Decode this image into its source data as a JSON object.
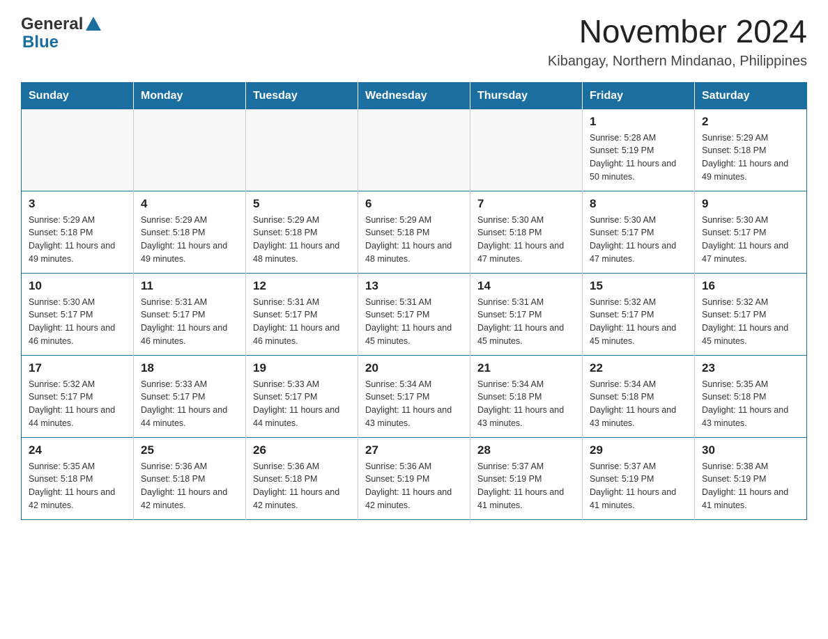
{
  "logo": {
    "text_general": "General",
    "text_blue": "Blue"
  },
  "title": "November 2024",
  "subtitle": "Kibangay, Northern Mindanao, Philippines",
  "days_of_week": [
    "Sunday",
    "Monday",
    "Tuesday",
    "Wednesday",
    "Thursday",
    "Friday",
    "Saturday"
  ],
  "weeks": [
    [
      {
        "day": "",
        "info": ""
      },
      {
        "day": "",
        "info": ""
      },
      {
        "day": "",
        "info": ""
      },
      {
        "day": "",
        "info": ""
      },
      {
        "day": "",
        "info": ""
      },
      {
        "day": "1",
        "info": "Sunrise: 5:28 AM\nSunset: 5:19 PM\nDaylight: 11 hours and 50 minutes."
      },
      {
        "day": "2",
        "info": "Sunrise: 5:29 AM\nSunset: 5:18 PM\nDaylight: 11 hours and 49 minutes."
      }
    ],
    [
      {
        "day": "3",
        "info": "Sunrise: 5:29 AM\nSunset: 5:18 PM\nDaylight: 11 hours and 49 minutes."
      },
      {
        "day": "4",
        "info": "Sunrise: 5:29 AM\nSunset: 5:18 PM\nDaylight: 11 hours and 49 minutes."
      },
      {
        "day": "5",
        "info": "Sunrise: 5:29 AM\nSunset: 5:18 PM\nDaylight: 11 hours and 48 minutes."
      },
      {
        "day": "6",
        "info": "Sunrise: 5:29 AM\nSunset: 5:18 PM\nDaylight: 11 hours and 48 minutes."
      },
      {
        "day": "7",
        "info": "Sunrise: 5:30 AM\nSunset: 5:18 PM\nDaylight: 11 hours and 47 minutes."
      },
      {
        "day": "8",
        "info": "Sunrise: 5:30 AM\nSunset: 5:17 PM\nDaylight: 11 hours and 47 minutes."
      },
      {
        "day": "9",
        "info": "Sunrise: 5:30 AM\nSunset: 5:17 PM\nDaylight: 11 hours and 47 minutes."
      }
    ],
    [
      {
        "day": "10",
        "info": "Sunrise: 5:30 AM\nSunset: 5:17 PM\nDaylight: 11 hours and 46 minutes."
      },
      {
        "day": "11",
        "info": "Sunrise: 5:31 AM\nSunset: 5:17 PM\nDaylight: 11 hours and 46 minutes."
      },
      {
        "day": "12",
        "info": "Sunrise: 5:31 AM\nSunset: 5:17 PM\nDaylight: 11 hours and 46 minutes."
      },
      {
        "day": "13",
        "info": "Sunrise: 5:31 AM\nSunset: 5:17 PM\nDaylight: 11 hours and 45 minutes."
      },
      {
        "day": "14",
        "info": "Sunrise: 5:31 AM\nSunset: 5:17 PM\nDaylight: 11 hours and 45 minutes."
      },
      {
        "day": "15",
        "info": "Sunrise: 5:32 AM\nSunset: 5:17 PM\nDaylight: 11 hours and 45 minutes."
      },
      {
        "day": "16",
        "info": "Sunrise: 5:32 AM\nSunset: 5:17 PM\nDaylight: 11 hours and 45 minutes."
      }
    ],
    [
      {
        "day": "17",
        "info": "Sunrise: 5:32 AM\nSunset: 5:17 PM\nDaylight: 11 hours and 44 minutes."
      },
      {
        "day": "18",
        "info": "Sunrise: 5:33 AM\nSunset: 5:17 PM\nDaylight: 11 hours and 44 minutes."
      },
      {
        "day": "19",
        "info": "Sunrise: 5:33 AM\nSunset: 5:17 PM\nDaylight: 11 hours and 44 minutes."
      },
      {
        "day": "20",
        "info": "Sunrise: 5:34 AM\nSunset: 5:17 PM\nDaylight: 11 hours and 43 minutes."
      },
      {
        "day": "21",
        "info": "Sunrise: 5:34 AM\nSunset: 5:18 PM\nDaylight: 11 hours and 43 minutes."
      },
      {
        "day": "22",
        "info": "Sunrise: 5:34 AM\nSunset: 5:18 PM\nDaylight: 11 hours and 43 minutes."
      },
      {
        "day": "23",
        "info": "Sunrise: 5:35 AM\nSunset: 5:18 PM\nDaylight: 11 hours and 43 minutes."
      }
    ],
    [
      {
        "day": "24",
        "info": "Sunrise: 5:35 AM\nSunset: 5:18 PM\nDaylight: 11 hours and 42 minutes."
      },
      {
        "day": "25",
        "info": "Sunrise: 5:36 AM\nSunset: 5:18 PM\nDaylight: 11 hours and 42 minutes."
      },
      {
        "day": "26",
        "info": "Sunrise: 5:36 AM\nSunset: 5:18 PM\nDaylight: 11 hours and 42 minutes."
      },
      {
        "day": "27",
        "info": "Sunrise: 5:36 AM\nSunset: 5:19 PM\nDaylight: 11 hours and 42 minutes."
      },
      {
        "day": "28",
        "info": "Sunrise: 5:37 AM\nSunset: 5:19 PM\nDaylight: 11 hours and 41 minutes."
      },
      {
        "day": "29",
        "info": "Sunrise: 5:37 AM\nSunset: 5:19 PM\nDaylight: 11 hours and 41 minutes."
      },
      {
        "day": "30",
        "info": "Sunrise: 5:38 AM\nSunset: 5:19 PM\nDaylight: 11 hours and 41 minutes."
      }
    ]
  ]
}
